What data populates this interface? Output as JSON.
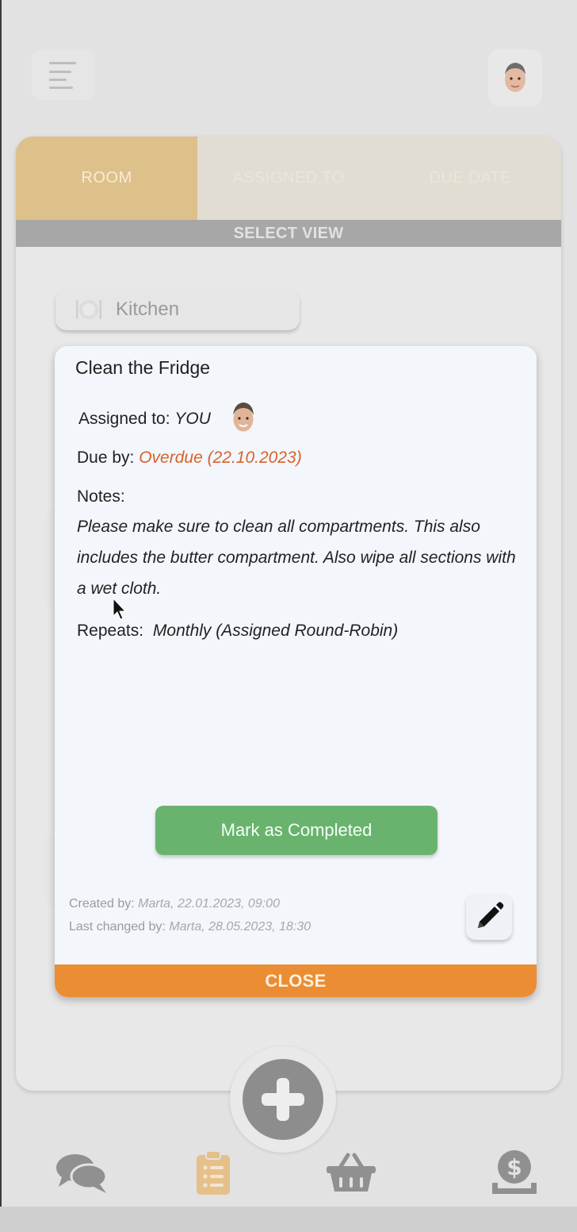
{
  "header": {
    "menu_icon": "hamburger-icon",
    "avatar_icon": "user-avatar-icon"
  },
  "tabs": [
    {
      "label": "ROOM",
      "active": true
    },
    {
      "label": "ASSIGNED TO",
      "active": false
    },
    {
      "label": "DUE DATE",
      "active": false
    }
  ],
  "select_view": "SELECT VIEW",
  "room": {
    "label": "Kitchen",
    "icon": "plate-icon"
  },
  "modal": {
    "title": "Clean the Fridge",
    "assigned_label": "Assigned to:",
    "assigned_value": "YOU",
    "due_label": "Due by:",
    "due_value": "Overdue (22.10.2023)",
    "notes_label": "Notes:",
    "notes_text": "Please make sure to clean all compartments. This also includes the butter compartment. Also wipe all sections with a wet cloth.",
    "repeats_label": "Repeats:",
    "repeats_value": "Monthly  (Assigned Round-Robin)",
    "mark_button": "Mark as Completed",
    "created_label": "Created by:",
    "created_value": "Marta, 22.01.2023, 09:00",
    "changed_label": "Last changed by:",
    "changed_value": "Marta, 28.05.2023, 18:30",
    "close_button": "CLOSE"
  },
  "colors": {
    "tab_active": "#dec08a",
    "overdue": "#d9622b",
    "complete_button": "#6ab36e",
    "close_bar": "#eb8d33"
  },
  "bottom_nav": [
    {
      "name": "chat",
      "icon": "chat-icon",
      "active": false
    },
    {
      "name": "tasks",
      "icon": "clipboard-list-icon",
      "active": true
    },
    {
      "name": "shopping",
      "icon": "basket-icon",
      "active": false
    },
    {
      "name": "finance",
      "icon": "money-icon",
      "active": false
    }
  ]
}
